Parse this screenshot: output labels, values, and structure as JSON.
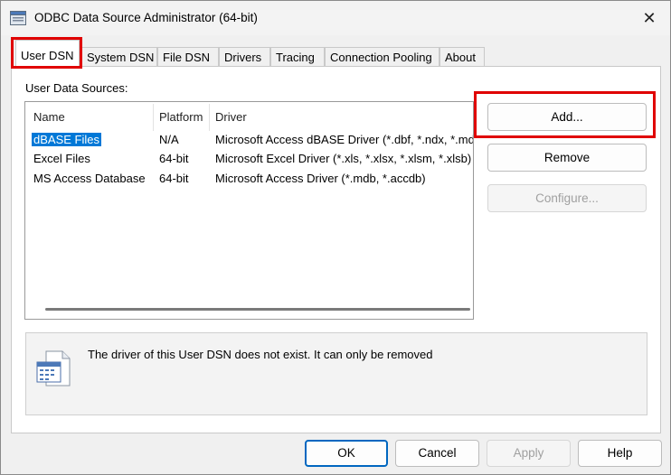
{
  "window": {
    "title": "ODBC Data Source Administrator (64-bit)",
    "close_glyph": "✕"
  },
  "tabs": [
    {
      "label": "User DSN",
      "active": true
    },
    {
      "label": "System DSN"
    },
    {
      "label": "File DSN"
    },
    {
      "label": "Drivers"
    },
    {
      "label": "Tracing"
    },
    {
      "label": "Connection Pooling"
    },
    {
      "label": "About"
    }
  ],
  "list": {
    "label": "User Data Sources:",
    "columns": [
      "Name",
      "Platform",
      "Driver"
    ],
    "rows": [
      {
        "name": "dBASE Files",
        "platform": "N/A",
        "driver": "Microsoft Access dBASE Driver (*.dbf, *.ndx, *.mdx)",
        "selected": true
      },
      {
        "name": "Excel Files",
        "platform": "64-bit",
        "driver": "Microsoft Excel Driver (*.xls, *.xlsx, *.xlsm, *.xlsb)"
      },
      {
        "name": "MS Access Database",
        "platform": "64-bit",
        "driver": "Microsoft Access Driver (*.mdb, *.accdb)"
      }
    ]
  },
  "side_buttons": {
    "add": "Add...",
    "remove": "Remove",
    "configure": "Configure..."
  },
  "info": {
    "text": "The driver of this User DSN does not exist. It can only be removed"
  },
  "footer": {
    "ok": "OK",
    "cancel": "Cancel",
    "apply": "Apply",
    "help": "Help"
  },
  "colors": {
    "highlight_box": "#e00000",
    "selection": "#0078d7",
    "default_button_border": "#0067c0"
  }
}
